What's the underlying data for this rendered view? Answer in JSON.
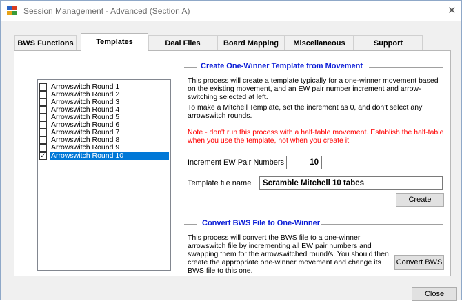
{
  "window": {
    "title": "Session Management - Advanced (Section A)"
  },
  "tabs": [
    {
      "label": "BWS Functions"
    },
    {
      "label": "Templates"
    },
    {
      "label": "Deal Files"
    },
    {
      "label": "Board Mapping"
    },
    {
      "label": "Miscellaneous"
    },
    {
      "label": "Support"
    }
  ],
  "active_tab": "Templates",
  "rounds_list": {
    "items": [
      {
        "label": "Arrowswitch Round 1",
        "checked": false
      },
      {
        "label": "Arrowswitch Round 2",
        "checked": false
      },
      {
        "label": "Arrowswitch Round 3",
        "checked": false
      },
      {
        "label": "Arrowswitch Round 4",
        "checked": false
      },
      {
        "label": "Arrowswitch Round 5",
        "checked": false
      },
      {
        "label": "Arrowswitch Round 6",
        "checked": false
      },
      {
        "label": "Arrowswitch Round 7",
        "checked": false
      },
      {
        "label": "Arrowswitch Round 8",
        "checked": false
      },
      {
        "label": "Arrowswitch Round 9",
        "checked": false
      },
      {
        "label": "Arrowswitch Round 10",
        "checked": true,
        "selected": true
      }
    ]
  },
  "create_section": {
    "title": "Create One-Winner Template from Movement",
    "para1": "This process will create a template typically for a one-winner movement based on the existing movement, and an EW pair number increment and arrow-switching selected at left.",
    "para2": "To make a Mitchell Template, set the increment as 0, and don't select any arrowswitch rounds.",
    "note": "Note - don't run this process with a half-table movement. Establish the half-table when you use the template, not when you create it.",
    "increment_label": "Increment EW Pair Numbers by",
    "increment_value": "10",
    "filename_label": "Template file name",
    "filename_value": "Scramble Mitchell 10 tabes",
    "create_button": "Create"
  },
  "convert_section": {
    "title": "Convert BWS File to One-Winner",
    "para": "This process will convert the BWS file to a one-winner arrowswitch file by incrementing all EW pair numbers and swapping them for the arrowswitched round/s. You should then create the appropriate one-winner movement and change its BWS file to this one.",
    "convert_button": "Convert BWS"
  },
  "close_button": "Close",
  "colors": {
    "accent_blue": "#0b1dd6",
    "warning_red": "#ff0000",
    "selection": "#0078d7"
  }
}
